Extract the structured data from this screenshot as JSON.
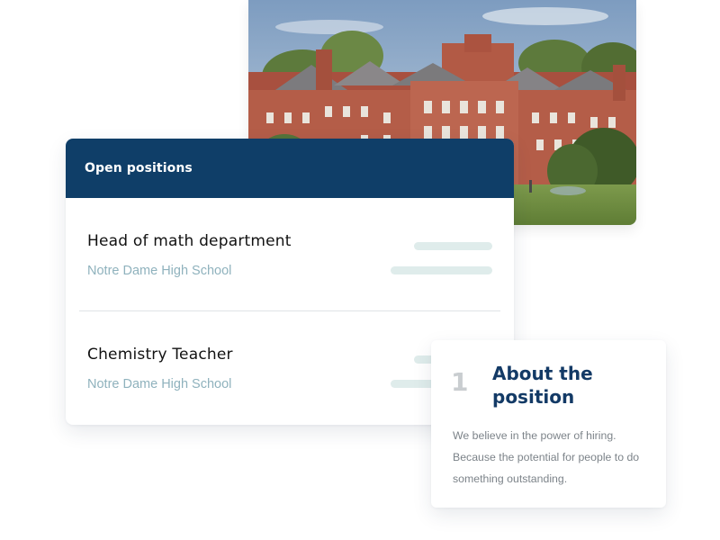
{
  "photo": {
    "subject": "campus-photo"
  },
  "positions": {
    "header_title": "Open positions",
    "items": [
      {
        "title": "Head of math department",
        "school": "Notre Dame High School"
      },
      {
        "title": "Chemistry Teacher",
        "school": "Notre Dame High School"
      }
    ]
  },
  "about": {
    "number": "1",
    "title": "About the position",
    "body": "We believe in the power of hiring. Because the potential for people to do something outstanding."
  },
  "colors": {
    "header_bg": "#0f3e68",
    "about_title": "#133a66",
    "school_text": "#8fb2bd",
    "placeholder_bar": "#dfeceb"
  }
}
